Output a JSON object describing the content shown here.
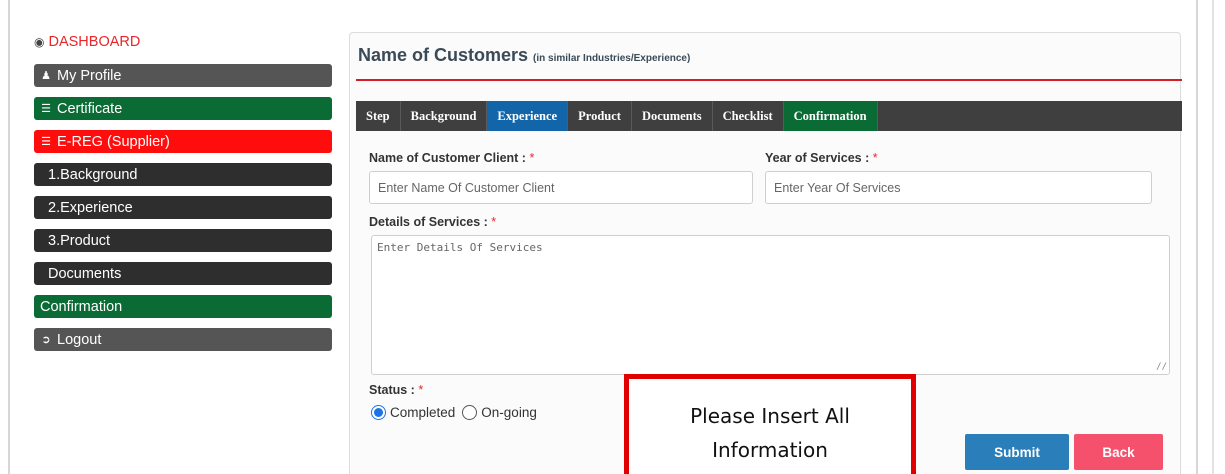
{
  "sidebar": {
    "dashboard": "DASHBOARD",
    "items": [
      {
        "label": "My Profile"
      },
      {
        "label": "Certificate"
      },
      {
        "label": "E-REG (Supplier)"
      },
      {
        "label": "1.Background"
      },
      {
        "label": "2.Experience"
      },
      {
        "label": "3.Product"
      },
      {
        "label": "Documents"
      },
      {
        "label": "Confirmation"
      },
      {
        "label": "Logout"
      }
    ]
  },
  "panel": {
    "title": "Name of Customers",
    "subtitle": "(in similar Industries/Experience)",
    "tabs": [
      {
        "label": "Step"
      },
      {
        "label": "Background"
      },
      {
        "label": "Experience"
      },
      {
        "label": "Product"
      },
      {
        "label": "Documents"
      },
      {
        "label": "Checklist"
      },
      {
        "label": "Confirmation"
      }
    ]
  },
  "form": {
    "customer_label": "Name of Customer Client :",
    "customer_placeholder": "Enter Name Of Customer Client",
    "year_label": "Year of Services :",
    "year_placeholder": "Enter Year Of Services",
    "details_label": "Details of Services :",
    "details_placeholder": "Enter Details Of Services",
    "required_mark": "*",
    "status_label": "Status :",
    "status_options": [
      {
        "label": "Completed",
        "selected": true
      },
      {
        "label": "On-going",
        "selected": false
      }
    ],
    "submit_label": "Submit",
    "back_label": "Back"
  },
  "callout": {
    "text": "Please Insert All Information"
  },
  "colors": {
    "accent_red": "#e8262a",
    "tab_blue": "#1265a8",
    "green": "#0a6b35",
    "submit": "#2a7fba",
    "back": "#f5516c"
  }
}
